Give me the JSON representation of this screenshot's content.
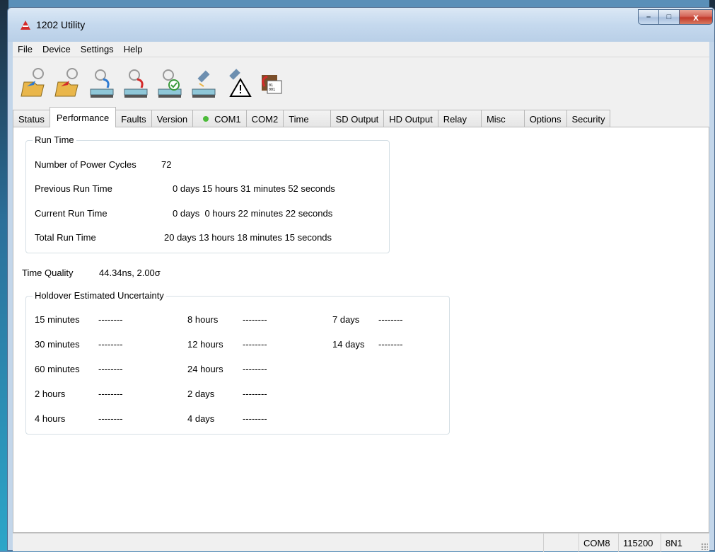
{
  "window": {
    "title": "1202 Utility",
    "minimize": "–",
    "maximize": "□",
    "close": "x"
  },
  "menu": [
    "File",
    "Device",
    "Settings",
    "Help"
  ],
  "toolbar": [
    {
      "icon": "open-config-icon"
    },
    {
      "icon": "save-config-icon"
    },
    {
      "icon": "read-device-icon"
    },
    {
      "icon": "write-device-icon"
    },
    {
      "icon": "verify-device-icon"
    },
    {
      "icon": "satellite-connect-icon"
    },
    {
      "icon": "satellite-warning-icon"
    },
    {
      "icon": "firmware-update-icon"
    }
  ],
  "tabs": [
    {
      "label": "Status"
    },
    {
      "label": "Performance",
      "active": true
    },
    {
      "label": "Faults"
    },
    {
      "label": "Version"
    },
    {
      "label": "COM1",
      "status_dot": "#4cbb3a"
    },
    {
      "label": "COM2"
    },
    {
      "label": "Time"
    },
    {
      "label": "SD Output"
    },
    {
      "label": "HD Output"
    },
    {
      "label": "Relay"
    },
    {
      "label": "Misc"
    },
    {
      "label": "Options"
    },
    {
      "label": "Security"
    }
  ],
  "run_time": {
    "legend": "Run Time",
    "power_cycles_label": "Number of Power Cycles",
    "power_cycles_value": "72",
    "previous_label": "Previous Run Time",
    "previous_value": "0 days 15 hours 31 minutes 52 seconds",
    "current_label": "Current Run Time",
    "current_value": "0 days  0 hours 22 minutes 22 seconds",
    "total_label": "Total Run Time",
    "total_value": "20 days 13 hours 18 minutes 15 seconds"
  },
  "time_quality": {
    "label": "Time Quality",
    "value": "44.34ns, 2.00σ"
  },
  "holdover": {
    "legend": "Holdover Estimated Uncertainty",
    "col1": [
      {
        "label": "15 minutes",
        "value": "--------"
      },
      {
        "label": "30 minutes",
        "value": "--------"
      },
      {
        "label": "60 minutes",
        "value": "--------"
      },
      {
        "label": "2 hours",
        "value": "--------"
      },
      {
        "label": "4 hours",
        "value": "--------"
      }
    ],
    "col2": [
      {
        "label": "8 hours",
        "value": "--------"
      },
      {
        "label": "12 hours",
        "value": "--------"
      },
      {
        "label": "24 hours",
        "value": "--------"
      },
      {
        "label": "2 days",
        "value": "--------"
      },
      {
        "label": "4 days",
        "value": "--------"
      }
    ],
    "col3": [
      {
        "label": "7 days",
        "value": "--------"
      },
      {
        "label": "14 days",
        "value": "--------"
      }
    ]
  },
  "statusbar": {
    "port": "COM8",
    "baud": "115200",
    "format": "8N1"
  }
}
